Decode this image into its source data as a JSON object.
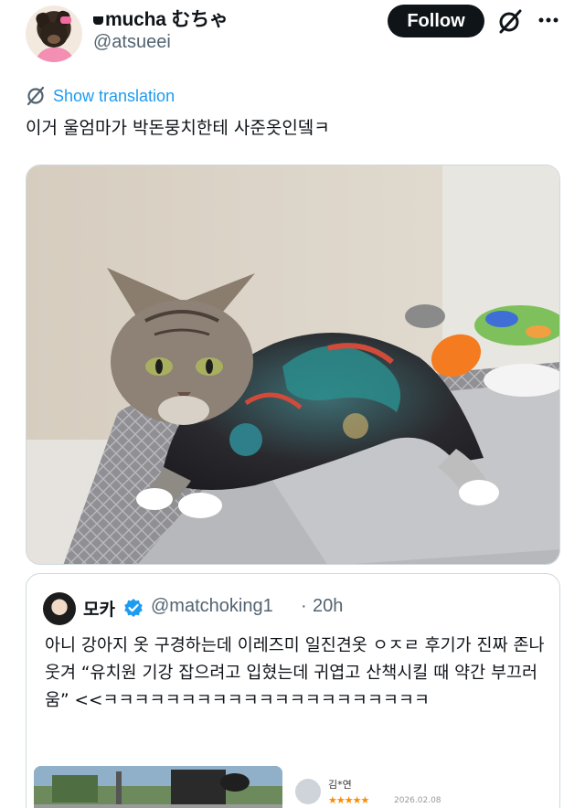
{
  "author": {
    "display_name": "mucha むちゃ",
    "handle": "@atsueei"
  },
  "actions": {
    "follow_label": "Follow"
  },
  "translate": {
    "label": "Show translation"
  },
  "tweet": {
    "text": "이거 울엄마가 박돈뭉치한테 사준옷인뎈ㅋ"
  },
  "quote": {
    "name": "모카",
    "handle": "@matchoking1",
    "separator": "·",
    "time": "20h",
    "text": "아니 강아지 옷 구경하는데 이레즈미 일진견옷 ㅇㅈㄹ 후기가 진짜 존나웃겨 “유치원 기강 잡으려고 입혔는데 귀엽고 산책시킬 때 약간 부끄러움” <<ㅋㅋㅋㅋㅋㅋㅋㅋㅋㅋㅋㅋㅋㅋㅋㅋㅋㅋㅋㅋㅋ",
    "review_name": "김*연",
    "review_stars": "★★★★★",
    "review_date": "2026.02.08"
  },
  "icons": {
    "grok": "grok-icon",
    "more": "more-icon",
    "globe": "globe-icon",
    "verified": "verified-icon",
    "mug": "mug-icon"
  },
  "colors": {
    "accent": "#1d9bf0",
    "text": "#0f1419",
    "secondary": "#536471",
    "border": "#cfd9de"
  }
}
